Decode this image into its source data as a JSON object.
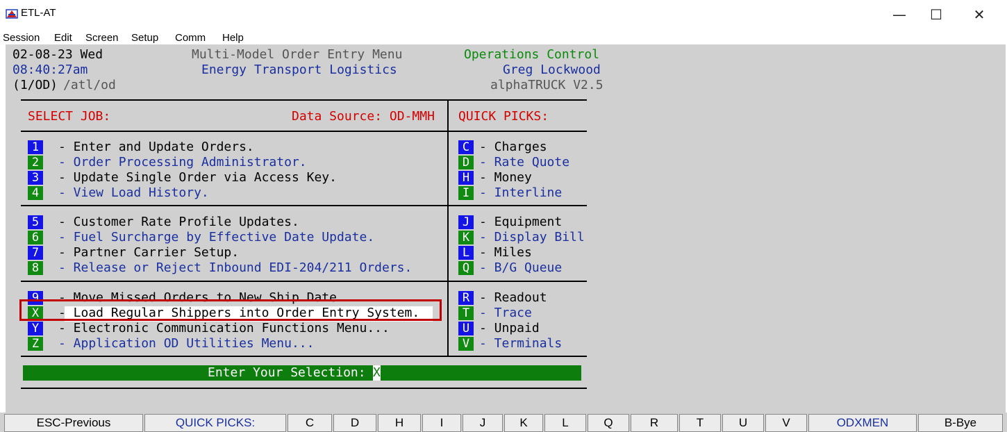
{
  "window": {
    "title": "ETL-AT",
    "minimize": "—",
    "maximize": "☐",
    "close": "✕"
  },
  "menu": [
    "Session",
    "Edit",
    "Screen",
    "Setup",
    "Comm",
    "Help"
  ],
  "header": {
    "date": "02-08-23 Wed",
    "time": "08:40:27am",
    "session": "(1/OD)",
    "path": "/atl/od",
    "menu_title": "Multi-Model Order Entry Menu",
    "company": "Energy Transport Logistics",
    "dept": "Operations Control",
    "user": "Greg Lockwood",
    "version": "alphaTRUCK V2.5"
  },
  "select_job": {
    "label": "SELECT JOB:",
    "data_source": "Data Source: OD-MMH"
  },
  "quick_picks_label": "QUICK PICKS:",
  "jobs": [
    {
      "key": "1",
      "label": "- Enter and Update Orders."
    },
    {
      "key": "2",
      "label": "- Order Processing Administrator."
    },
    {
      "key": "3",
      "label": "- Update Single Order via Access Key."
    },
    {
      "key": "4",
      "label": "- View Load History."
    },
    {
      "key": "5",
      "label": "- Customer Rate Profile Updates."
    },
    {
      "key": "6",
      "label": "- Fuel Surcharge by Effective Date Update."
    },
    {
      "key": "7",
      "label": "- Partner Carrier Setup."
    },
    {
      "key": "8",
      "label": "- Release or Reject Inbound EDI-204/211 Orders."
    },
    {
      "key": "9",
      "label": "- Move Missed Orders to New Ship Date."
    },
    {
      "key": "X",
      "label": "- Load Regular Shippers into Order Entry System."
    },
    {
      "key": "Y",
      "label": "- Electronic Communication Functions Menu..."
    },
    {
      "key": "Z",
      "label": "- Application OD Utilities Menu..."
    }
  ],
  "picks": [
    {
      "key": "C",
      "label": "- Charges"
    },
    {
      "key": "D",
      "label": "- Rate Quote"
    },
    {
      "key": "H",
      "label": "- Money"
    },
    {
      "key": "I",
      "label": "- Interline"
    },
    {
      "key": "J",
      "label": "- Equipment"
    },
    {
      "key": "K",
      "label": "- Display Bill"
    },
    {
      "key": "L",
      "label": "- Miles"
    },
    {
      "key": "Q",
      "label": "- B/G Queue"
    },
    {
      "key": "R",
      "label": "- Readout"
    },
    {
      "key": "T",
      "label": "- Trace"
    },
    {
      "key": "U",
      "label": "- Unpaid"
    },
    {
      "key": "V",
      "label": "- Terminals"
    }
  ],
  "prompt": {
    "label": "Enter Your Selection:",
    "value": "X"
  },
  "function_keys": [
    "ESC-Previous",
    "QUICK PICKS:",
    "C",
    "D",
    "H",
    "I",
    "J",
    "K",
    "L",
    "Q",
    "R",
    "T",
    "U",
    "V",
    "ODXMEN",
    "B-Bye"
  ],
  "colors": {
    "terminal_bg": "#d0d0d0",
    "key_blue": "#1414e6",
    "key_green": "#108a10",
    "text_blue": "#1a2fa0",
    "text_green": "#0a8a0a",
    "text_red": "#d40000",
    "highlight_box": "#c00000"
  }
}
